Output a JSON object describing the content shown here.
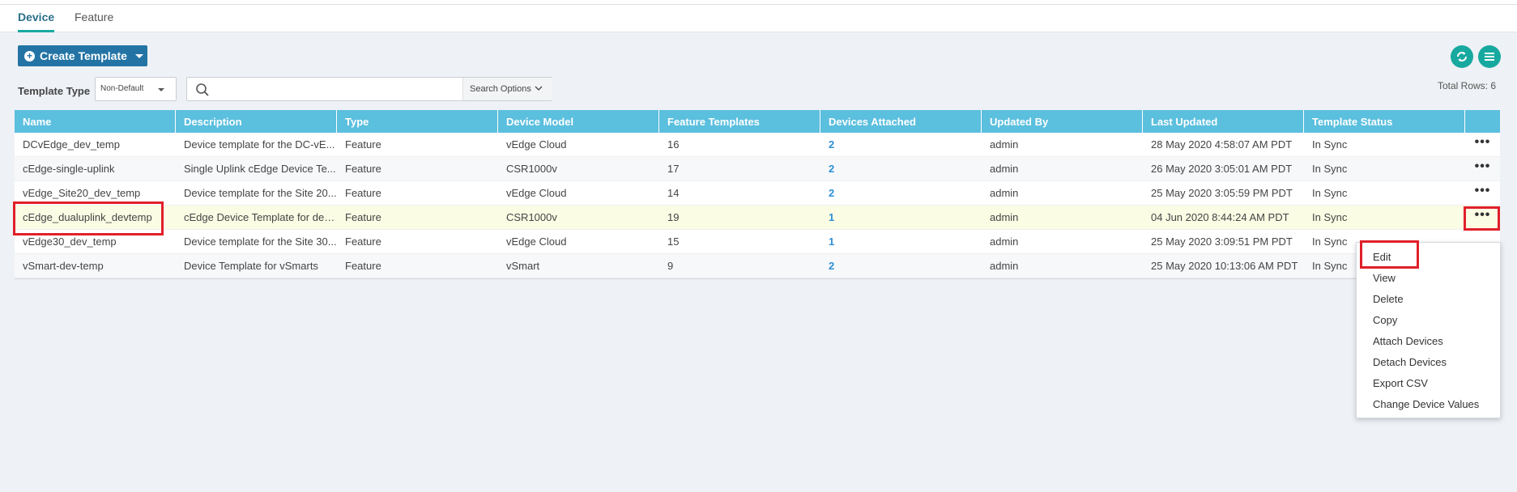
{
  "tabs": [
    {
      "label": "Device",
      "active": true
    },
    {
      "label": "Feature",
      "active": false
    }
  ],
  "toolbar": {
    "create_label": "Create Template",
    "template_type_label": "Template Type",
    "template_type_value": "Non-Default",
    "search_placeholder": "",
    "search_options_label": "Search Options",
    "total_rows": "Total Rows: 6"
  },
  "icons": {
    "refresh": "refresh-icon",
    "menu": "list-menu-icon",
    "search": "search-icon"
  },
  "colors": {
    "header": "#5bbfde",
    "accent": "#17a99f",
    "primary_button": "#2374a5",
    "link": "#2d8fd5",
    "highlight_row": "#fbfce4",
    "annotation": "#e0202a"
  },
  "table": {
    "columns": [
      "Name",
      "Description",
      "Type",
      "Device Model",
      "Feature Templates",
      "Devices Attached",
      "Updated By",
      "Last Updated",
      "Template Status"
    ],
    "rows": [
      {
        "name": "DCvEdge_dev_temp",
        "description": "Device template for the DC-vE...",
        "type": "Feature",
        "model": "vEdge Cloud",
        "feature_templates": "16",
        "devices": "2",
        "updated_by": "admin",
        "last_updated": "28 May 2020 4:58:07 AM PDT",
        "status": "In Sync",
        "actions": "•••"
      },
      {
        "name": "cEdge-single-uplink",
        "description": "Single Uplink cEdge Device Te...",
        "type": "Feature",
        "model": "CSR1000v",
        "feature_templates": "17",
        "devices": "2",
        "updated_by": "admin",
        "last_updated": "26 May 2020 3:05:01 AM PDT",
        "status": "In Sync",
        "actions": "•••"
      },
      {
        "name": "vEdge_Site20_dev_temp",
        "description": "Device template for the Site 20...",
        "type": "Feature",
        "model": "vEdge Cloud",
        "feature_templates": "14",
        "devices": "2",
        "updated_by": "admin",
        "last_updated": "25 May 2020 3:05:59 PM PDT",
        "status": "In Sync",
        "actions": "•••"
      },
      {
        "name": "cEdge_dualuplink_devtemp",
        "description": "cEdge Device Template for dev...",
        "type": "Feature",
        "model": "CSR1000v",
        "feature_templates": "19",
        "devices": "1",
        "updated_by": "admin",
        "last_updated": "04 Jun 2020 8:44:24 AM PDT",
        "status": "In Sync",
        "actions": "•••"
      },
      {
        "name": "vEdge30_dev_temp",
        "description": "Device template for the Site 30...",
        "type": "Feature",
        "model": "vEdge Cloud",
        "feature_templates": "15",
        "devices": "1",
        "updated_by": "admin",
        "last_updated": "25 May 2020 3:09:51 PM PDT",
        "status": "In Sync",
        "actions": ""
      },
      {
        "name": "vSmart-dev-temp",
        "description": "Device Template for vSmarts",
        "type": "Feature",
        "model": "vSmart",
        "feature_templates": "9",
        "devices": "2",
        "updated_by": "admin",
        "last_updated": "25 May 2020 10:13:06 AM PDT",
        "status": "In Sync",
        "actions": ""
      }
    ]
  },
  "context_menu": {
    "items": [
      "Edit",
      "View",
      "Delete",
      "Copy",
      "Attach Devices",
      "Detach Devices",
      "Export CSV",
      "Change Device Values"
    ]
  }
}
